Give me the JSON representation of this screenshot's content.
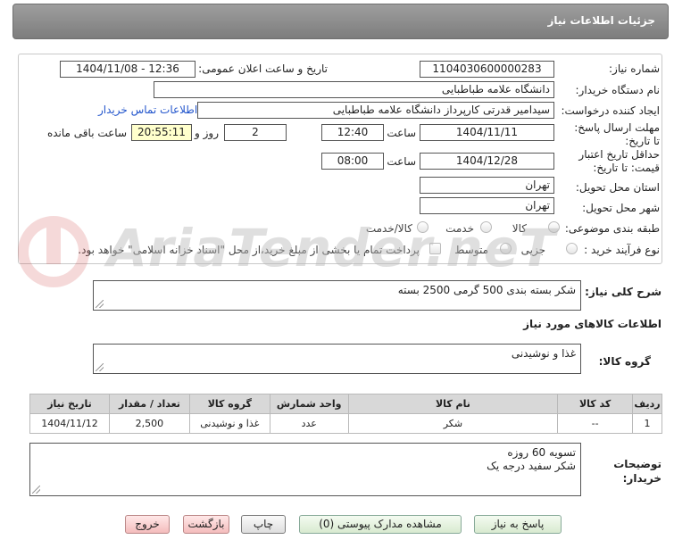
{
  "header": {
    "title": "جزئیات اطلاعات نیاز"
  },
  "form": {
    "need_number_label": "شماره نیاز:",
    "need_number": "1104030600000283",
    "announce_label": "تاریخ و ساعت اعلان عمومی:",
    "announce_value": "1404/11/08 - 12:36",
    "buyer_label": "نام دستگاه خریدار:",
    "buyer_value": "دانشگاه علامه طباطبایی",
    "creator_label": "ایجاد کننده درخواست:",
    "creator_value": "سیدامیر قدرتی کارپرداز دانشگاه علامه طباطبایی",
    "contact_link": "اطلاعات تماس خریدار",
    "deadline_label": "مهلت ارسال پاسخ: تا تاریخ:",
    "deadline_date": "1404/11/11",
    "time_label": "ساعت",
    "deadline_time": "12:40",
    "days_value": "2",
    "days_label": "روز و",
    "remaining_time": "20:55:11",
    "remaining_label": "ساعت باقی مانده",
    "validity_label": "حداقل تاریخ اعتبار قیمت: تا تاریخ:",
    "validity_date": "1404/12/28",
    "validity_time": "08:00",
    "province_label": "استان محل تحویل:",
    "province_value": "تهران",
    "city_label": "شهر محل تحویل:",
    "city_value": "تهران",
    "category_label": "طبقه بندی موضوعی:",
    "category_options": [
      "کالا",
      "خدمت",
      "کالا/خدمت"
    ],
    "process_label": "نوع فرآیند خرید :",
    "process_options": [
      "جزیی",
      "متوسط"
    ],
    "payment_note": "پرداخت تمام یا بخشی از مبلغ خرید،از محل \"اسناد خزانه اسلامی\" خواهد بود."
  },
  "summary": {
    "label": "شرح کلی نیاز:",
    "value": "شکر بسته بندی 500 گرمی 2500 بسته"
  },
  "goods_info_title": "اطلاعات کالاهای مورد نیاز",
  "goods_group": {
    "label": "گروه کالا:",
    "value": "غذا و نوشیدنی"
  },
  "table": {
    "headers": [
      "ردیف",
      "کد کالا",
      "نام کالا",
      "واحد شمارش",
      "گروه کالا",
      "تعداد / مقدار",
      "تاریخ نیاز"
    ],
    "rows": [
      [
        "1",
        "--",
        "شکر",
        "عدد",
        "غذا و نوشیدنی",
        "2,500",
        "1404/11/12"
      ]
    ]
  },
  "buyer_notes": {
    "label": "توضیحات خریدار:",
    "line1": "تسویه 60 روزه",
    "line2": "شکر سفید درجه یک"
  },
  "buttons": {
    "reply": "پاسخ به نیاز",
    "attachments": "مشاهده مدارک پیوستی (0)",
    "print": "چاپ",
    "back": "بازگشت",
    "exit": "خروج"
  },
  "watermark": {
    "text": "AriaTender.neT"
  },
  "colors": {
    "header": "#8c8c8c",
    "remaining_bg": "#ffffcc",
    "link": "#2255cc",
    "pink_button": "#f4bcbc",
    "green_button": "#d8ead0"
  }
}
